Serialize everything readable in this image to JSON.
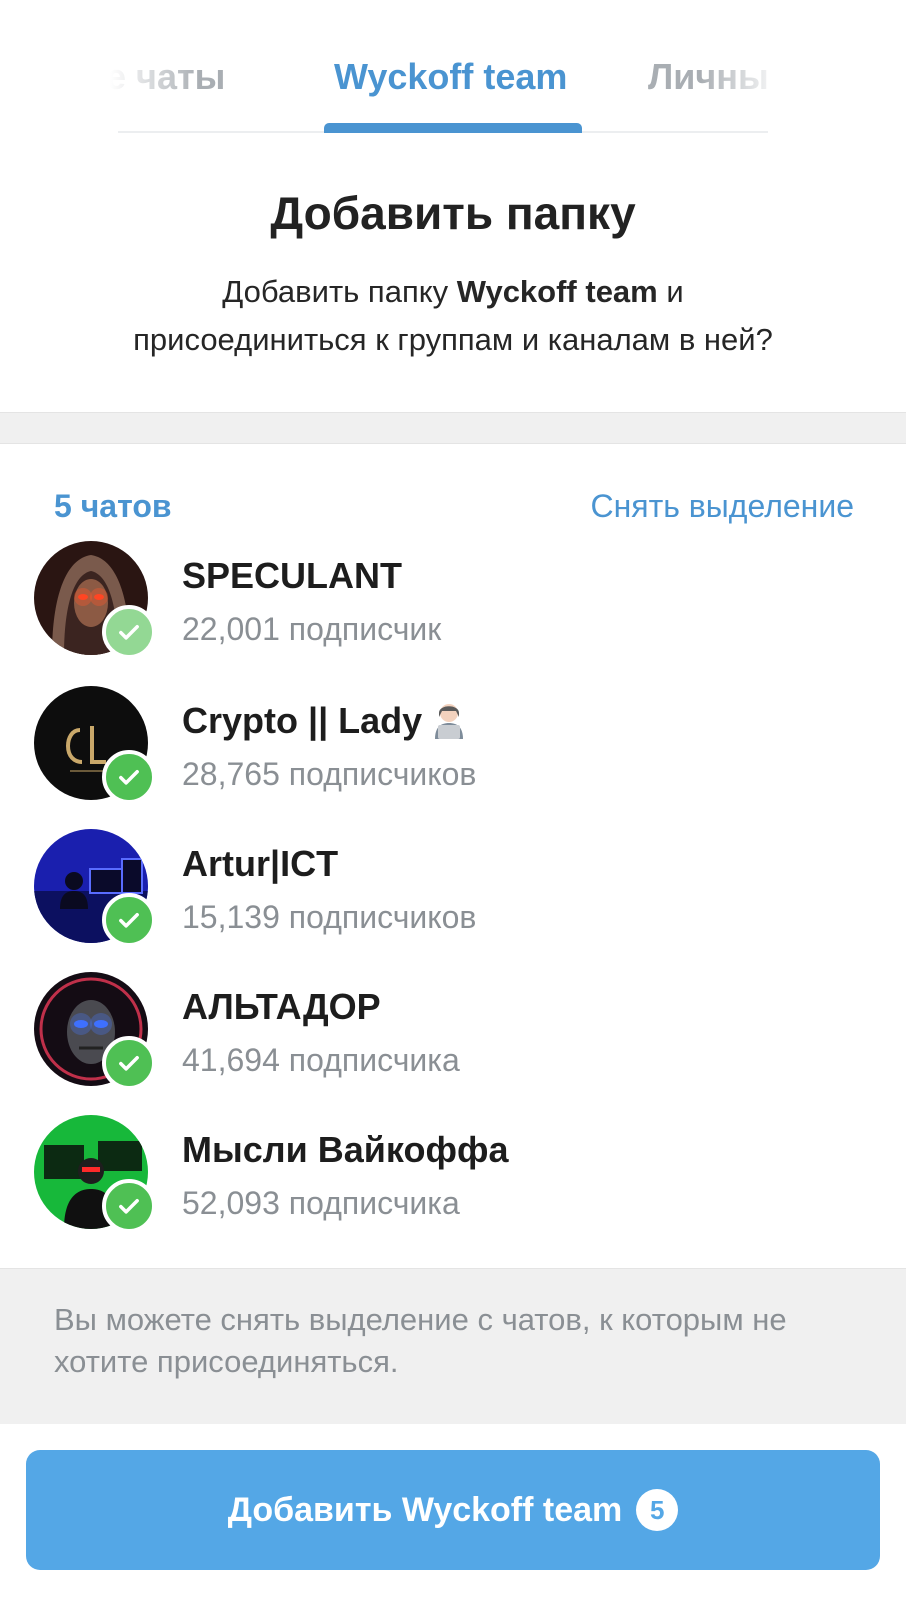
{
  "tabs": [
    {
      "label": "се чаты"
    },
    {
      "label": "Wyckoff team"
    },
    {
      "label": "Личны"
    }
  ],
  "dialog": {
    "title": "Добавить папку",
    "desc_prefix": "Добавить папку ",
    "desc_folder": "Wyckoff team",
    "desc_line1_suffix": " и",
    "desc_line2": "присоединиться к группам и каналам в ней?"
  },
  "list": {
    "count_label": "5 чатов",
    "deselect_label": "Снять выделение",
    "items": [
      {
        "name": "SPECULANT",
        "subscribers": "22,001 подписчик"
      },
      {
        "name": "Crypto || Lady",
        "subscribers": "28,765 подписчиков"
      },
      {
        "name": "Artur|ICT",
        "subscribers": "15,139 подписчиков"
      },
      {
        "name": "АЛЬТАДОР",
        "subscribers": "41,694 подписчика"
      },
      {
        "name": "Мысли Вайкоффа",
        "subscribers": "52,093 подписчика"
      }
    ]
  },
  "note": "Вы можете снять выделение с чатов, к которым не хотите присоединяться.",
  "button": {
    "label": "Добавить Wyckoff team",
    "badge": "5"
  },
  "colors": {
    "accent": "#4a94d1",
    "button": "#54a7e6",
    "check": "#4fc054"
  }
}
